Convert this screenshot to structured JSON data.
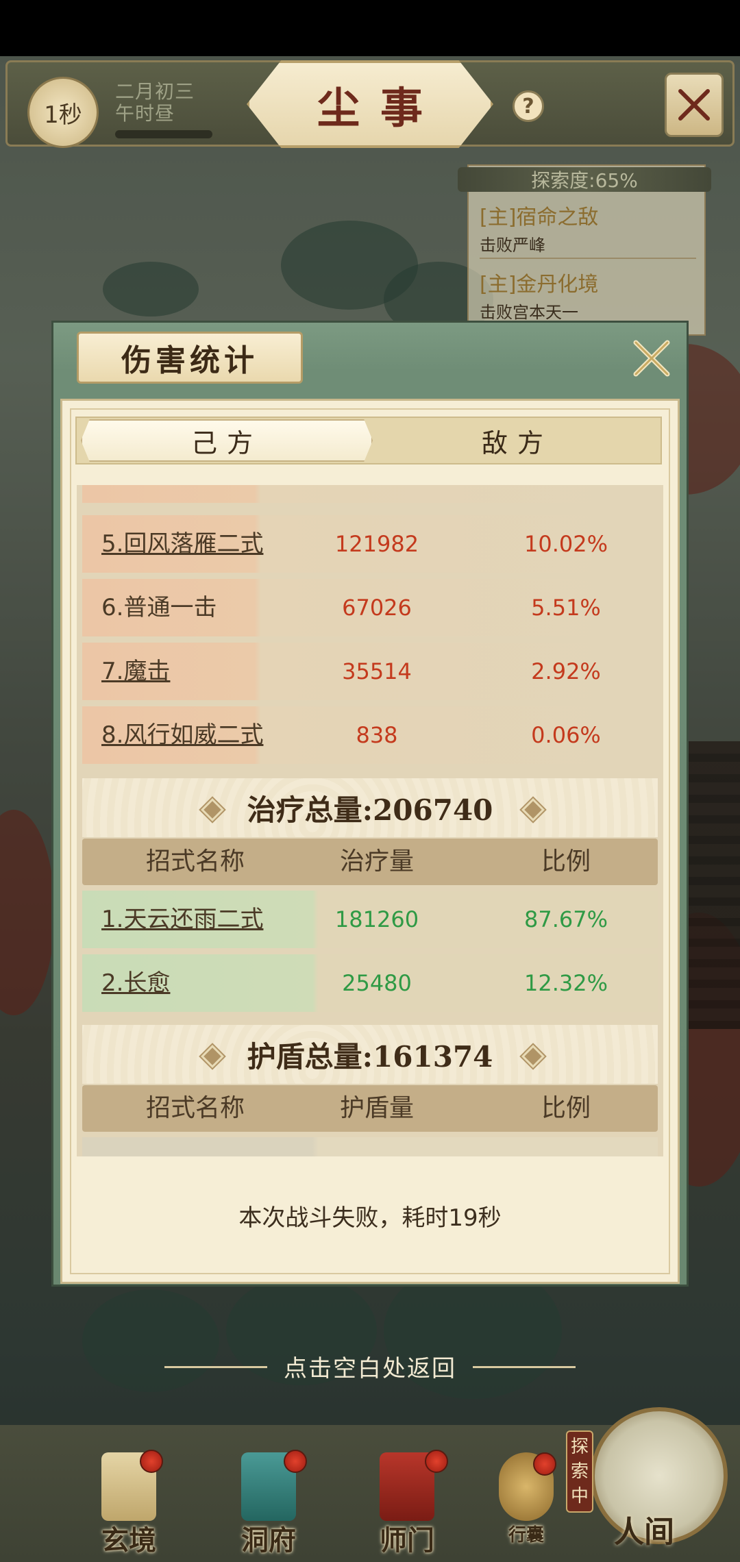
{
  "top_bar": {
    "time_badge": "1秒",
    "date": "二月初三",
    "time_of_day": "午时昼",
    "title": "尘事",
    "help_icon": "question-icon",
    "close_icon": "crossed-swords-icon"
  },
  "quest_panel": {
    "exploration": "探索度:65%",
    "quests": [
      {
        "title": "[主]宿命之敌",
        "subtitle": "击败严峰"
      },
      {
        "title": "[主]金丹化境",
        "subtitle": "击败宫本天一"
      }
    ]
  },
  "modal": {
    "title": "伤害统计",
    "close_icon": "close-x-icon",
    "tabs": {
      "own": "己方",
      "enemy": "敌方"
    },
    "damage_rows": [
      {
        "name": "5.回风落雁二式",
        "value": "121982",
        "pct": "10.02%"
      },
      {
        "name": "6.普通一击",
        "value": "67026",
        "pct": "5.51%"
      },
      {
        "name": "7.魔击",
        "value": "35514",
        "pct": "2.92%"
      },
      {
        "name": "8.风行如威二式",
        "value": "838",
        "pct": "0.06%"
      }
    ],
    "heal_section": {
      "banner": "治疗总量:206740",
      "headers": {
        "name": "招式名称",
        "value": "治疗量",
        "pct": "比例"
      },
      "rows": [
        {
          "name": "1.天云还雨二式",
          "value": "181260",
          "pct": "87.67%"
        },
        {
          "name": "2.长愈",
          "value": "25480",
          "pct": "12.32%"
        }
      ]
    },
    "shield_section": {
      "banner": "护盾总量:161374",
      "headers": {
        "name": "招式名称",
        "value": "护盾量",
        "pct": "比例"
      }
    },
    "result": "本次战斗失败，耗时19秒"
  },
  "return_hint": "点击空白处返回",
  "bottom_nav": {
    "items": [
      {
        "label": "玄境",
        "icon": "scroll-icon"
      },
      {
        "label": "洞府",
        "icon": "lantern-icon"
      },
      {
        "label": "师门",
        "icon": "banner-icon"
      },
      {
        "label": "行囊",
        "icon": "bag-icon"
      }
    ],
    "world": {
      "label": "人间",
      "tag": "探索中"
    }
  },
  "colors": {
    "damage": "#c43a1d",
    "heal": "#2f9a45",
    "panel_green": "#6f8d76",
    "parchment": "#f6eed6"
  }
}
